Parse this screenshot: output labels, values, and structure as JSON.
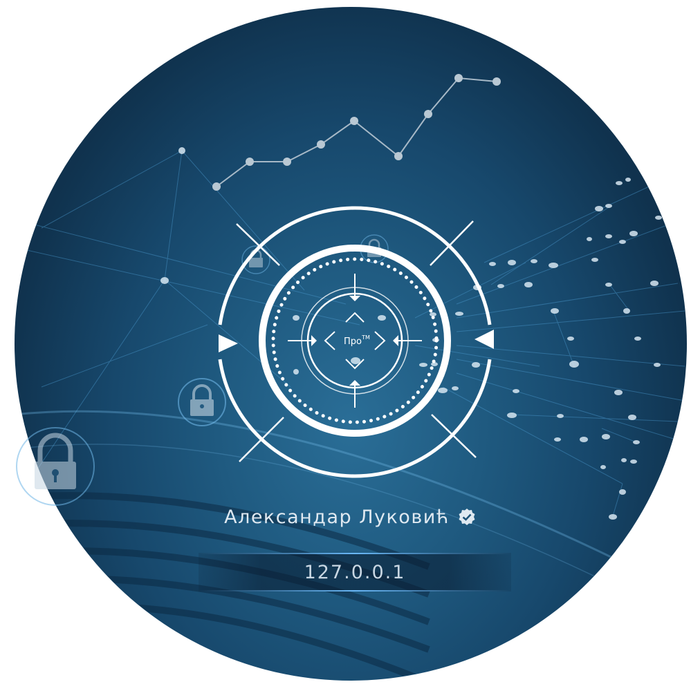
{
  "user": {
    "name": "Александар Луковић",
    "verified_icon": "verified-check-icon"
  },
  "connection": {
    "address": "127.0.0.1"
  },
  "logo": {
    "text": "Про",
    "trademark": "TM"
  },
  "colors": {
    "accent": "#6ebeff",
    "text": "#dfe9f1"
  }
}
